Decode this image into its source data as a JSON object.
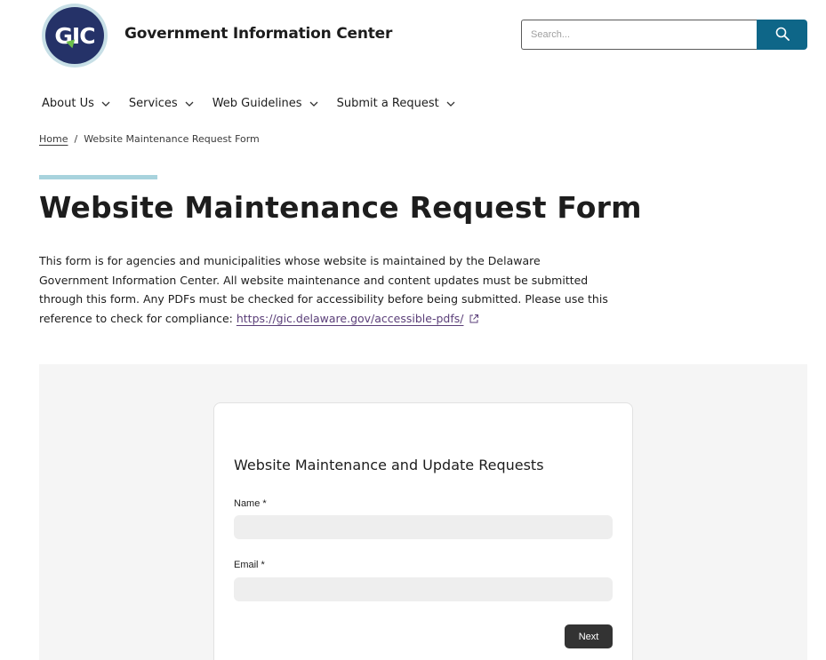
{
  "header": {
    "logo_text": "GIC",
    "site_title": "Government Information Center",
    "search_placeholder": "Search..."
  },
  "nav": {
    "items": [
      {
        "label": "About Us"
      },
      {
        "label": "Services"
      },
      {
        "label": "Web Guidelines"
      },
      {
        "label": "Submit a Request"
      }
    ]
  },
  "breadcrumb": {
    "home": "Home",
    "separator": "/",
    "current": "Website Maintenance Request Form"
  },
  "page": {
    "title": "Website Maintenance Request Form",
    "intro_text": "This form is for agencies and municipalities whose website is maintained by the Delaware Government Information Center. All website maintenance and content updates must be submitted through this form. Any PDFs must be checked for accessibility before being submitted. Please use this reference to check for compliance:",
    "intro_link": "https://gic.delaware.gov/accessible-pdfs/"
  },
  "form": {
    "title": "Website Maintenance and Update Requests",
    "name_label": "Name *",
    "email_label": "Email *",
    "next_label": "Next"
  },
  "colors": {
    "brand_navy": "#253268",
    "accent_teal": "#0e6688",
    "accent_bar": "#a8d3dd",
    "link_purple": "#5a3e78"
  }
}
